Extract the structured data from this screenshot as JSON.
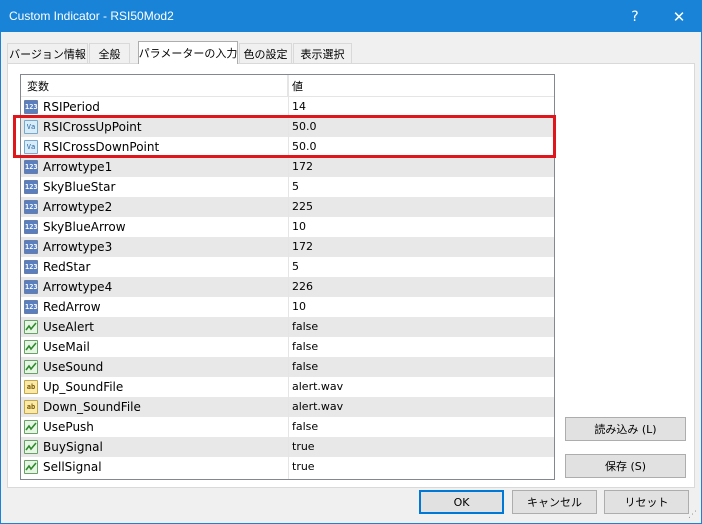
{
  "window": {
    "title": "Custom Indicator - RSI50Mod2",
    "help_glyph": "?",
    "close_glyph": "✕"
  },
  "tabs": [
    {
      "label": "バージョン情報"
    },
    {
      "label": "全般"
    },
    {
      "label": "パラメーターの入力",
      "active": true
    },
    {
      "label": "色の設定"
    },
    {
      "label": "表示選択"
    }
  ],
  "grid": {
    "headers": {
      "name": "変数",
      "value": "値"
    },
    "rows": [
      {
        "icon": "int-icon",
        "icon_text": "123",
        "name": "RSIPeriod",
        "value": "14"
      },
      {
        "icon": "double-icon",
        "icon_text": "Va",
        "name": "RSICrossUpPoint",
        "value": "50.0"
      },
      {
        "icon": "double-icon",
        "icon_text": "Va",
        "name": "RSICrossDownPoint",
        "value": "50.0"
      },
      {
        "icon": "int-icon",
        "icon_text": "123",
        "name": "Arrowtype1",
        "value": "172"
      },
      {
        "icon": "int-icon",
        "icon_text": "123",
        "name": "SkyBlueStar",
        "value": "5"
      },
      {
        "icon": "int-icon",
        "icon_text": "123",
        "name": "Arrowtype2",
        "value": "225"
      },
      {
        "icon": "int-icon",
        "icon_text": "123",
        "name": "SkyBlueArrow",
        "value": "10"
      },
      {
        "icon": "int-icon",
        "icon_text": "123",
        "name": "Arrowtype3",
        "value": "172"
      },
      {
        "icon": "int-icon",
        "icon_text": "123",
        "name": "RedStar",
        "value": "5"
      },
      {
        "icon": "int-icon",
        "icon_text": "123",
        "name": "Arrowtype4",
        "value": "226"
      },
      {
        "icon": "int-icon",
        "icon_text": "123",
        "name": "RedArrow",
        "value": "10"
      },
      {
        "icon": "bool-icon",
        "icon_text": "",
        "name": "UseAlert",
        "value": "false"
      },
      {
        "icon": "bool-icon",
        "icon_text": "",
        "name": "UseMail",
        "value": "false"
      },
      {
        "icon": "bool-icon",
        "icon_text": "",
        "name": "UseSound",
        "value": "false"
      },
      {
        "icon": "string-icon",
        "icon_text": "ab",
        "name": "Up_SoundFile",
        "value": "alert.wav"
      },
      {
        "icon": "string-icon",
        "icon_text": "ab",
        "name": "Down_SoundFile",
        "value": "alert.wav"
      },
      {
        "icon": "bool-icon",
        "icon_text": "",
        "name": "UsePush",
        "value": "false"
      },
      {
        "icon": "bool-icon",
        "icon_text": "",
        "name": "BuySignal",
        "value": "true"
      },
      {
        "icon": "bool-icon",
        "icon_text": "",
        "name": "SellSignal",
        "value": "true"
      }
    ]
  },
  "side_buttons": {
    "load": "読み込み (L)",
    "save": "保存 (S)"
  },
  "footer_buttons": {
    "ok": "OK",
    "cancel": "キャンセル",
    "reset": "リセット"
  },
  "colors": {
    "titlebar": "#1883d7",
    "highlight": "#e0161d",
    "alt_row": "#e8e8e8"
  }
}
